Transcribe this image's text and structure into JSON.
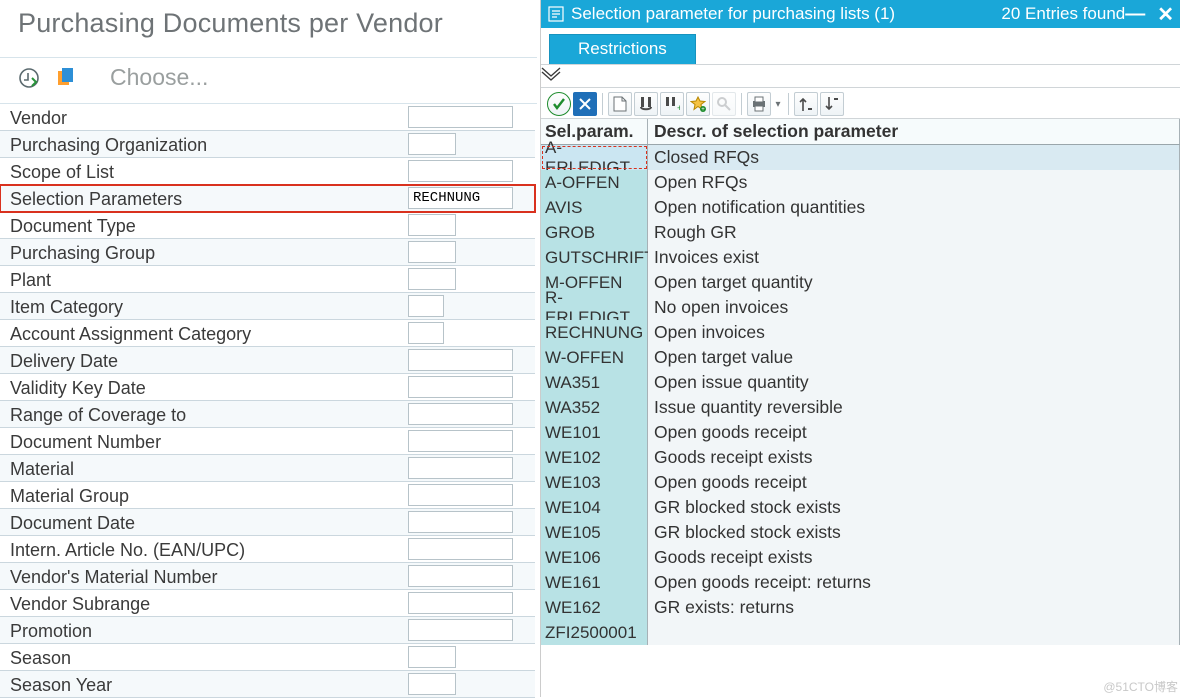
{
  "page_title": "Purchasing Documents per Vendor",
  "toolbar_left": {
    "choose_label": "Choose..."
  },
  "form": {
    "rows": [
      {
        "label": "Vendor",
        "value": "",
        "w": "normal"
      },
      {
        "label": "Purchasing Organization",
        "value": "",
        "w": "narrow"
      },
      {
        "label": "Scope of List",
        "value": "",
        "w": "normal"
      },
      {
        "label": "Selection Parameters",
        "value": "RECHNUNG",
        "w": "normal",
        "highlight": true
      },
      {
        "label": "Document Type",
        "value": "",
        "w": "narrow"
      },
      {
        "label": "Purchasing Group",
        "value": "",
        "w": "narrow"
      },
      {
        "label": "Plant",
        "value": "",
        "w": "narrow"
      },
      {
        "label": "Item Category",
        "value": "",
        "w": "small"
      },
      {
        "label": "Account Assignment Category",
        "value": "",
        "w": "small"
      },
      {
        "label": "Delivery Date",
        "value": "",
        "w": "normal"
      },
      {
        "label": "Validity Key Date",
        "value": "",
        "w": "normal"
      },
      {
        "label": "Range of Coverage to",
        "value": "",
        "w": "normal"
      },
      {
        "label": "Document Number",
        "value": "",
        "w": "normal"
      },
      {
        "label": "Material",
        "value": "",
        "w": "normal"
      },
      {
        "label": "Material Group",
        "value": "",
        "w": "normal"
      },
      {
        "label": "Document Date",
        "value": "",
        "w": "normal"
      },
      {
        "label": "Intern. Article No. (EAN/UPC)",
        "value": "",
        "w": "normal"
      },
      {
        "label": "Vendor's Material Number",
        "value": "",
        "w": "normal"
      },
      {
        "label": "Vendor Subrange",
        "value": "",
        "w": "normal"
      },
      {
        "label": "Promotion",
        "value": "",
        "w": "normal"
      },
      {
        "label": "Season",
        "value": "",
        "w": "narrow"
      },
      {
        "label": "Season Year",
        "value": "",
        "w": "narrow"
      }
    ]
  },
  "dialog": {
    "title": "Selection parameter for purchasing lists (1)",
    "entries_found": "20 Entries found",
    "tab": "Restrictions"
  },
  "table": {
    "col1": "Sel.param.",
    "col2": "Descr. of selection parameter",
    "rows": [
      {
        "p": "A-ERLEDIGT",
        "d": "Closed RFQs",
        "sel": true
      },
      {
        "p": "A-OFFEN",
        "d": "Open RFQs"
      },
      {
        "p": "AVIS",
        "d": "Open notification quantities"
      },
      {
        "p": "GROB",
        "d": "Rough GR"
      },
      {
        "p": "GUTSCHRIFT",
        "d": "Invoices exist"
      },
      {
        "p": "M-OFFEN",
        "d": "Open target quantity"
      },
      {
        "p": "R-ERLEDIGT",
        "d": "No open invoices"
      },
      {
        "p": "RECHNUNG",
        "d": "Open invoices"
      },
      {
        "p": "W-OFFEN",
        "d": "Open target value"
      },
      {
        "p": "WA351",
        "d": "Open issue quantity"
      },
      {
        "p": "WA352",
        "d": "Issue quantity reversible"
      },
      {
        "p": "WE101",
        "d": "Open goods receipt"
      },
      {
        "p": "WE102",
        "d": "Goods receipt exists"
      },
      {
        "p": "WE103",
        "d": "Open goods receipt"
      },
      {
        "p": "WE104",
        "d": "GR blocked stock exists"
      },
      {
        "p": "WE105",
        "d": "GR blocked stock exists"
      },
      {
        "p": "WE106",
        "d": "Goods receipt exists"
      },
      {
        "p": "WE161",
        "d": "Open goods receipt: returns"
      },
      {
        "p": "WE162",
        "d": "GR exists: returns"
      },
      {
        "p": "ZFI2500001",
        "d": ""
      }
    ]
  },
  "watermark": "@51CTO博客"
}
